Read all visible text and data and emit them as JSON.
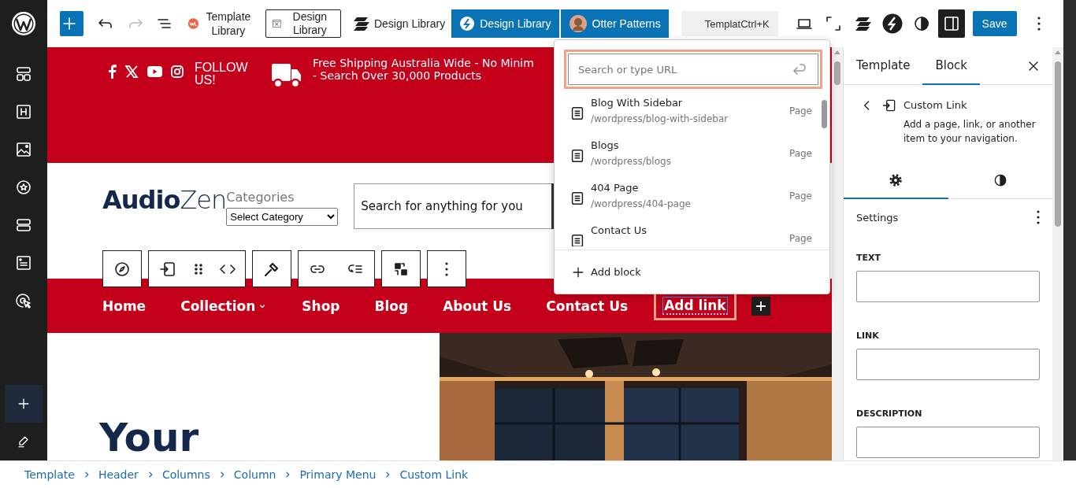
{
  "top_bar": {
    "redo_disabled": true,
    "plugin_buttons": [
      {
        "label": "Template Library",
        "kind": "plain"
      },
      {
        "label": "Design Library",
        "kind": "outlined"
      },
      {
        "label": "Design Library",
        "kind": "plain"
      },
      {
        "label": "Design Library",
        "kind": "primary"
      },
      {
        "label": "Otter Patterns",
        "kind": "primary"
      }
    ],
    "command": {
      "text": "Templat",
      "shortcut": "Ctrl+K"
    },
    "settings_pressed": true,
    "save_label": "Save"
  },
  "sidebar": {
    "inserter_active": true
  },
  "banner": {
    "follow_label": "FOLLOW US!",
    "shipping_text": "Free Shipping Australia Wide - No Minim\n- Search Over 30,000 Products"
  },
  "header": {
    "logo_bold": "Audio",
    "logo_light": "Zen",
    "categories_label": "Categories",
    "category_select": "Select Category",
    "search_placeholder": "Search for anything for you"
  },
  "nav": {
    "items": [
      {
        "label": "Home",
        "kind": "link",
        "selected": false
      },
      {
        "label": "Collection",
        "kind": "dropdown",
        "selected": false
      },
      {
        "label": "Shop",
        "kind": "link",
        "selected": false
      },
      {
        "label": "Blog",
        "kind": "link",
        "selected": false
      },
      {
        "label": "About Us",
        "kind": "link",
        "selected": false
      },
      {
        "label": "Contact Us",
        "kind": "link",
        "selected": false
      },
      {
        "label": "Add link",
        "kind": "link",
        "selected": true
      }
    ]
  },
  "hero": {
    "heading": "Your"
  },
  "link_popover": {
    "search_placeholder": "Search or type URL",
    "results": [
      {
        "title": "Blog With Sidebar",
        "path": "/wordpress/blog-with-sidebar",
        "type": "Page"
      },
      {
        "title": "Blogs",
        "path": "/wordpress/blogs",
        "type": "Page"
      },
      {
        "title": "404 Page",
        "path": "/wordpress/404-page",
        "type": "Page"
      },
      {
        "title": "Contact Us",
        "type": "Page"
      }
    ],
    "add_block_label": "Add block"
  },
  "settings_panel": {
    "tabs": [
      {
        "label": "Template",
        "selected": false
      },
      {
        "label": "Block",
        "selected": true
      }
    ],
    "block_title": "Custom Link",
    "block_description": "Add a page, link, or another item to your navigation.",
    "sub_tabs": [
      {
        "kind": "settings",
        "selected": true
      },
      {
        "kind": "styles",
        "selected": false
      }
    ],
    "section_title": "Settings",
    "fields": [
      {
        "label": "TEXT"
      },
      {
        "label": "LINK"
      },
      {
        "label": "DESCRIPTION"
      }
    ]
  },
  "breadcrumbs": [
    "Template",
    "Header",
    "Columns",
    "Column",
    "Primary Menu",
    "Custom Link"
  ]
}
